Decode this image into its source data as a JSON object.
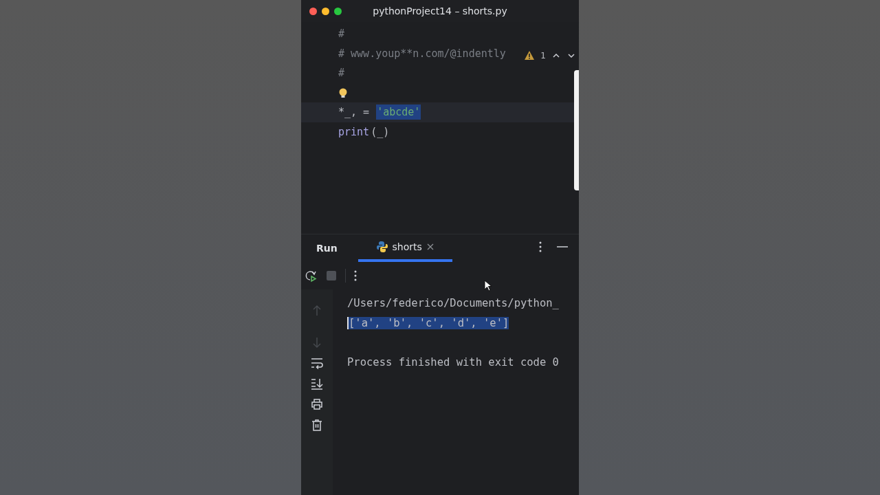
{
  "window": {
    "title": "pythonProject14 – shorts.py"
  },
  "editor": {
    "warning_count": "1",
    "lines": [
      {
        "kind": "code",
        "current": false,
        "tokens": [
          {
            "text": "#",
            "kind": "comment",
            "selected": false
          }
        ]
      },
      {
        "kind": "code",
        "current": false,
        "tokens": [
          {
            "text": "# www.youp**n.com/@indently",
            "kind": "comment",
            "selected": false
          }
        ]
      },
      {
        "kind": "code",
        "current": false,
        "tokens": [
          {
            "text": "#",
            "kind": "comment",
            "selected": false
          }
        ]
      },
      {
        "kind": "bulb",
        "current": false
      },
      {
        "kind": "code",
        "current": true,
        "tokens": [
          {
            "text": "*_, = ",
            "kind": "plain",
            "selected": false
          },
          {
            "text": "'abcde'",
            "kind": "string",
            "selected": true
          }
        ]
      },
      {
        "kind": "code",
        "current": false,
        "tokens": [
          {
            "text": "print",
            "kind": "builtin",
            "selected": false
          },
          {
            "text": "(_)",
            "kind": "plain",
            "selected": false
          }
        ]
      }
    ]
  },
  "run_panel": {
    "label": "Run",
    "tabs": [
      {
        "label": "shorts",
        "selected": true
      }
    ],
    "console": [
      {
        "text": "/Users/federico/Documents/python_",
        "selected": false,
        "blank_before": false
      },
      {
        "text": "['a', 'b', 'c', 'd', 'e']",
        "selected": true,
        "blank_before": false
      },
      {
        "text": "Process finished with exit code 0",
        "selected": false,
        "blank_before": true
      }
    ]
  }
}
